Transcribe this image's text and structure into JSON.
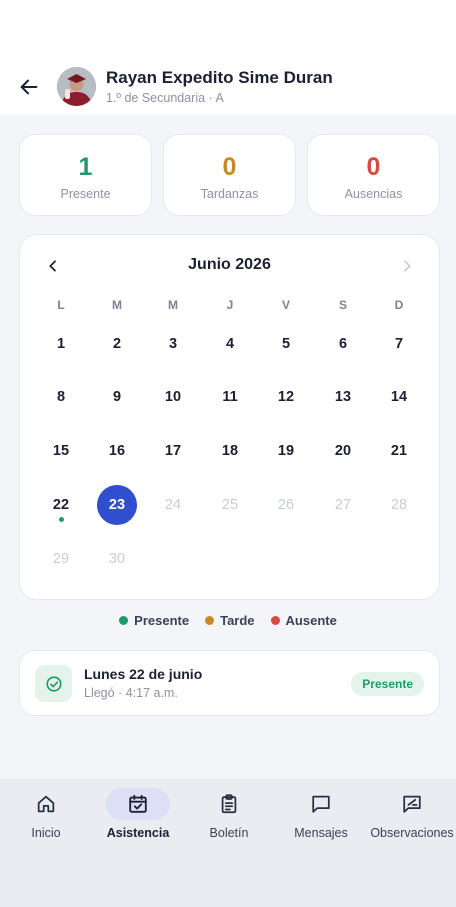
{
  "header": {
    "student_name": "Rayan Expedito Sime Duran",
    "student_grade": "1.º de Secundaria · A",
    "back_icon": "arrow-left-icon",
    "avatar": "student-avatar"
  },
  "stats": [
    {
      "value": "1",
      "label": "Presente",
      "color": "#1f9a6b"
    },
    {
      "value": "0",
      "label": "Tardanzas",
      "color": "#c98a22"
    },
    {
      "value": "0",
      "label": "Ausencias",
      "color": "#d74a3e"
    }
  ],
  "calendar": {
    "title": "Junio 2026",
    "prev_icon": "chevron-left-icon",
    "next_icon": "chevron-right-icon",
    "weekdays": [
      "L",
      "M",
      "M",
      "J",
      "V",
      "S",
      "D"
    ],
    "days": [
      {
        "label": "1"
      },
      {
        "label": "2"
      },
      {
        "label": "3"
      },
      {
        "label": "4"
      },
      {
        "label": "5"
      },
      {
        "label": "6"
      },
      {
        "label": "7"
      },
      {
        "label": "8"
      },
      {
        "label": "9"
      },
      {
        "label": "10"
      },
      {
        "label": "11"
      },
      {
        "label": "12"
      },
      {
        "label": "13"
      },
      {
        "label": "14"
      },
      {
        "label": "15"
      },
      {
        "label": "16"
      },
      {
        "label": "17"
      },
      {
        "label": "18"
      },
      {
        "label": "19"
      },
      {
        "label": "20"
      },
      {
        "label": "21"
      },
      {
        "label": "22",
        "status": "present"
      },
      {
        "label": "23",
        "selected": true
      },
      {
        "label": "24",
        "muted": true
      },
      {
        "label": "25",
        "muted": true
      },
      {
        "label": "26",
        "muted": true
      },
      {
        "label": "27",
        "muted": true
      },
      {
        "label": "28",
        "muted": true
      },
      {
        "label": "29",
        "muted": true
      },
      {
        "label": "30",
        "muted": true
      }
    ]
  },
  "legend": [
    {
      "label": "Presente",
      "color": "#1f9a6b"
    },
    {
      "label": "Tarde",
      "color": "#c98a22"
    },
    {
      "label": "Ausente",
      "color": "#d74a3e"
    }
  ],
  "record": {
    "title": "Lunes 22 de junio",
    "subtitle": "Llegó · 4:17 a.m.",
    "badge": "Presente",
    "icon": "check-circle-icon"
  },
  "nav": [
    {
      "label": "Inicio",
      "icon": "home-icon"
    },
    {
      "label": "Asistencia",
      "icon": "calendar-check-icon",
      "active": true
    },
    {
      "label": "Boletín",
      "icon": "clipboard-icon"
    },
    {
      "label": "Mensajes",
      "icon": "chat-icon"
    },
    {
      "label": "Observaciones",
      "icon": "note-edit-icon"
    }
  ]
}
